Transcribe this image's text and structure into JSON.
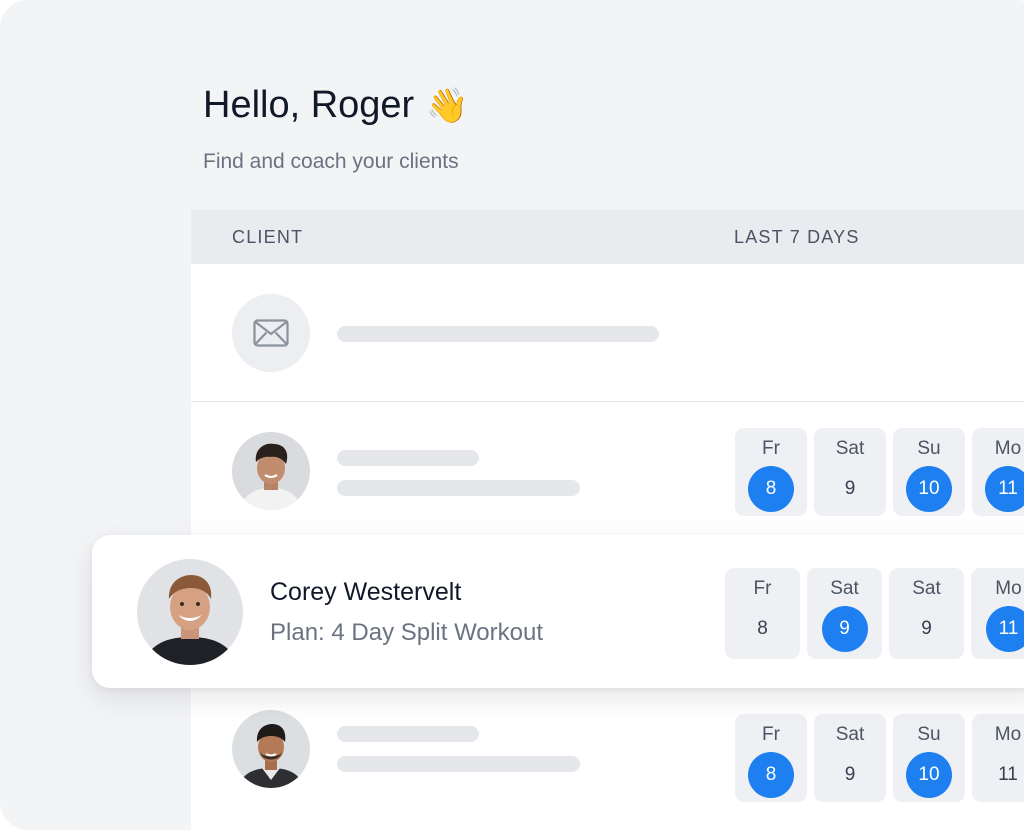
{
  "greeting": {
    "text": "Hello, Roger",
    "emoji": "👋"
  },
  "subtitle": "Find and coach your clients",
  "table": {
    "headers": {
      "client": "CLIENT",
      "last7": "LAST 7 DAYS"
    }
  },
  "rows": {
    "row2": {
      "days": [
        {
          "name": "Fr",
          "num": "8",
          "active": true
        },
        {
          "name": "Sat",
          "num": "9",
          "active": false
        },
        {
          "name": "Su",
          "num": "10",
          "active": true
        },
        {
          "name": "Mo",
          "num": "11",
          "active": true
        }
      ]
    },
    "row3": {
      "days": [
        {
          "name": "Fr",
          "num": "8",
          "active": true
        },
        {
          "name": "Sat",
          "num": "9",
          "active": false
        },
        {
          "name": "Su",
          "num": "10",
          "active": true
        },
        {
          "name": "Mo",
          "num": "11",
          "active": false
        }
      ]
    }
  },
  "card": {
    "name": "Corey Westervelt",
    "plan": "Plan: 4 Day Split Workout",
    "days": [
      {
        "name": "Fr",
        "num": "8",
        "active": false
      },
      {
        "name": "Sat",
        "num": "9",
        "active": true
      },
      {
        "name": "Sat",
        "num": "9",
        "active": false
      },
      {
        "name": "Mo",
        "num": "11",
        "active": true
      }
    ]
  },
  "colors": {
    "accent": "#1d7ff0",
    "background": "#f3f4f6"
  },
  "icons": {
    "invite": "mail-icon",
    "greeting": "waving-hand-emoji"
  }
}
